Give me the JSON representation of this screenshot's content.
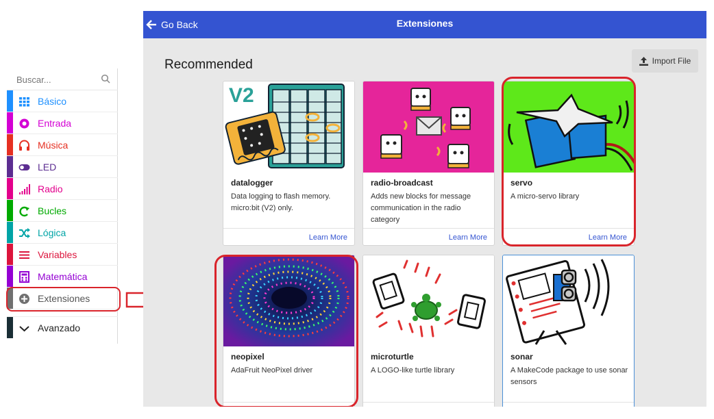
{
  "toolbox": {
    "search_placeholder": "Buscar...",
    "categories": [
      {
        "label": "Básico",
        "color": "#1e90ff",
        "icon": "grid-icon"
      },
      {
        "label": "Entrada",
        "color": "#d400d4",
        "icon": "target-icon"
      },
      {
        "label": "Música",
        "color": "#e63022",
        "icon": "headphones-icon"
      },
      {
        "label": "LED",
        "color": "#5c2d91",
        "icon": "toggle-icon"
      },
      {
        "label": "Radio",
        "color": "#e3008c",
        "icon": "signal-bars-icon"
      },
      {
        "label": "Bucles",
        "color": "#00aa00",
        "icon": "loop-arrow-icon"
      },
      {
        "label": "Lógica",
        "color": "#00a4a6",
        "icon": "shuffle-icon"
      },
      {
        "label": "Variables",
        "color": "#dc143c",
        "icon": "lines-icon"
      },
      {
        "label": "Matemática",
        "color": "#9400d3",
        "icon": "calculator-icon"
      },
      {
        "label": "Extensiones",
        "color": "#707070",
        "icon": "plus-circle-icon"
      },
      {
        "label": "Avanzado",
        "color": "#1a2e35",
        "icon": "chevron-down-icon"
      }
    ]
  },
  "header": {
    "back_label": "Go Back",
    "title": "Extensiones"
  },
  "section_title": "Recommended",
  "import_label": "Import File",
  "cards": [
    {
      "name": "datalogger",
      "desc": "Data logging to flash memory. micro:bit (V2) only.",
      "learn": "Learn More",
      "badge": "V2"
    },
    {
      "name": "radio-broadcast",
      "desc": "Adds new blocks for message communication in the radio category",
      "learn": "Learn More"
    },
    {
      "name": "servo",
      "desc": "A micro-servo library",
      "learn": "Learn More"
    },
    {
      "name": "neopixel",
      "desc": "AdaFruit NeoPixel driver",
      "learn": ""
    },
    {
      "name": "microturtle",
      "desc": "A LOGO-like turtle library",
      "learn": ""
    },
    {
      "name": "sonar",
      "desc": "A MakeCode package to use sonar sensors",
      "learn": ""
    }
  ],
  "colors": {
    "header": "#3454d1",
    "highlight": "#d9242b",
    "link": "#3454d1"
  }
}
